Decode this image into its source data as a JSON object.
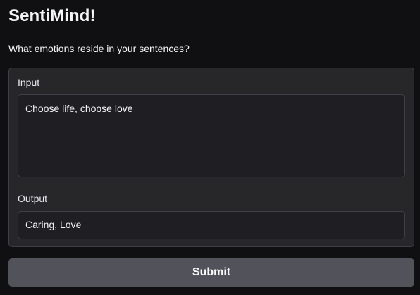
{
  "app": {
    "title": "SentiMind!",
    "description": "What emotions reside in your sentences?"
  },
  "input": {
    "label": "Input",
    "value": "Choose life, choose love"
  },
  "output": {
    "label": "Output",
    "value": "Caring, Love"
  },
  "actions": {
    "submit_label": "Submit"
  },
  "colors": {
    "background": "#101013",
    "panel": "#27272a",
    "field": "#1f1f23",
    "button": "#52525b",
    "text": "#f3f4f6"
  }
}
